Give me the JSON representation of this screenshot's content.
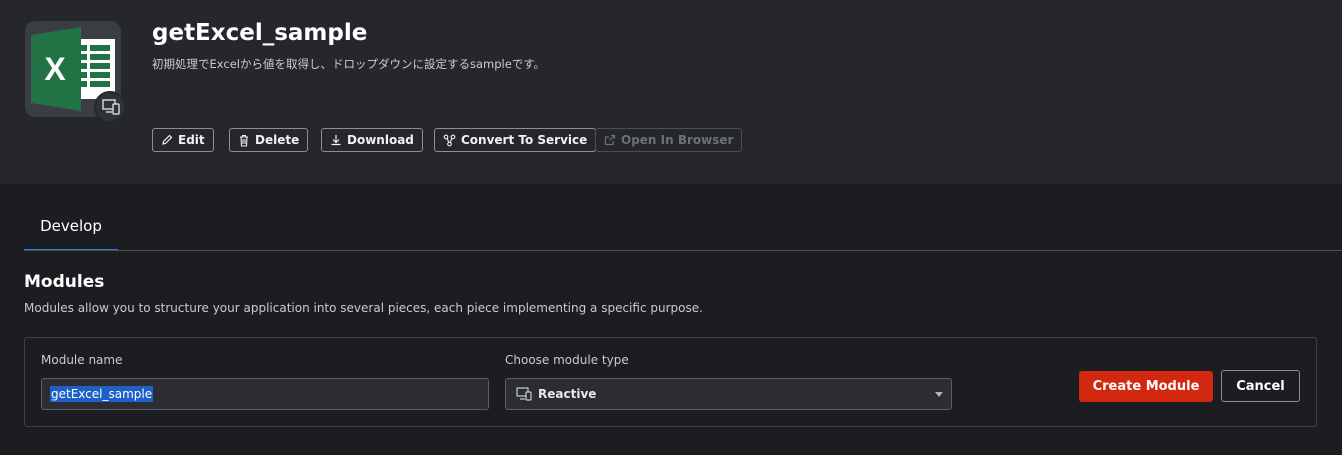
{
  "app": {
    "title": "getExcel_sample",
    "description": "初期処理でExcelから値を取得し、ドロップダウンに設定するsampleです。",
    "icon": "excel-icon",
    "badge_icon": "monitor-device-icon"
  },
  "toolbar": {
    "edit": "Edit",
    "delete": "Delete",
    "download": "Download",
    "convert": "Convert To Service",
    "open_browser": "Open In Browser"
  },
  "tabs": [
    {
      "label": "Develop",
      "active": true
    }
  ],
  "modules": {
    "title": "Modules",
    "description": "Modules allow you to structure your application into several pieces, each piece implementing a specific purpose.",
    "name_label": "Module name",
    "name_value": "getExcel_sample",
    "type_label": "Choose module type",
    "type_value": "Reactive",
    "create_button": "Create Module",
    "cancel_button": "Cancel"
  },
  "colors": {
    "accent": "#2f7de1",
    "create": "#d2280f",
    "excel_green": "#217346"
  }
}
